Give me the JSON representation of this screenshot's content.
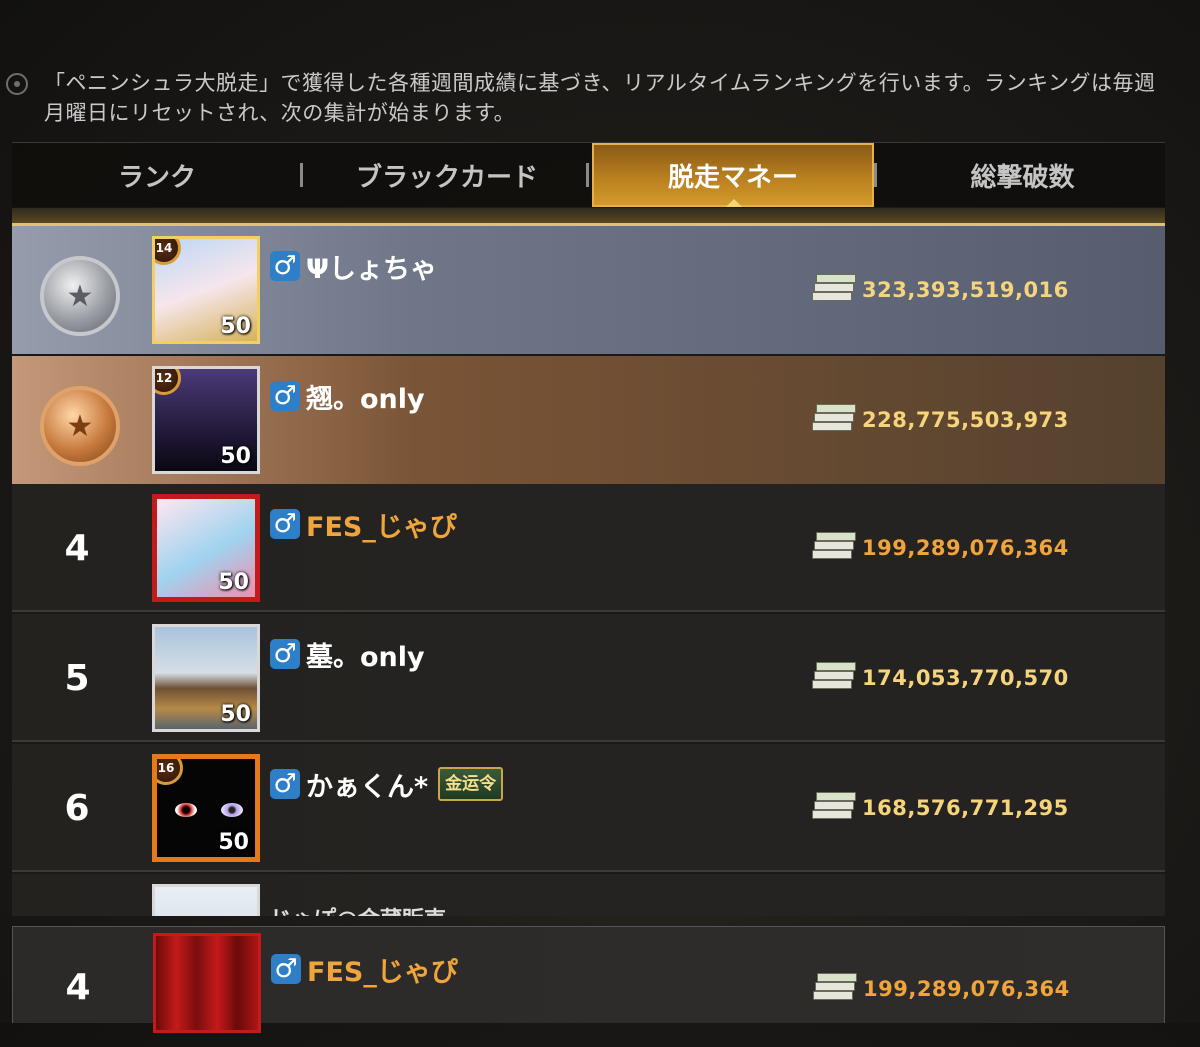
{
  "notice": "「ペニンシュラ大脱走」で獲得した各種週間成績に基づき、リアルタイムランキングを行います。ランキングは毎週月曜日にリセットされ、次の集計が始まります。",
  "tabs": [
    "ランク",
    "ブラックカード",
    "脱走マネー",
    "総撃破数"
  ],
  "active_tab": "脱走マネー",
  "rows": [
    {
      "rank": "",
      "medal": "silver",
      "name": "Ψしょちゃ",
      "level": "50",
      "badge": "14",
      "money": "323,393,519,016",
      "title_badge": ""
    },
    {
      "rank": "",
      "medal": "bronze",
      "name": "翘。only",
      "level": "50",
      "badge": "12",
      "money": "228,775,503,973",
      "title_badge": ""
    },
    {
      "rank": "4",
      "medal": "",
      "name": "FES_じゃぴ",
      "level": "50",
      "badge": "",
      "money": "199,289,076,364",
      "title_badge": ""
    },
    {
      "rank": "5",
      "medal": "",
      "name": "墓。only",
      "level": "50",
      "badge": "",
      "money": "174,053,770,570",
      "title_badge": ""
    },
    {
      "rank": "6",
      "medal": "",
      "name": "かぁくん*",
      "level": "50",
      "badge": "16",
      "money": "168,576,771,295",
      "title_badge": "金运令"
    },
    {
      "rank": "",
      "medal": "",
      "name": "じゃぽ@金蔵販売",
      "level": "",
      "badge": "",
      "money": "",
      "title_badge": ""
    }
  ],
  "self": {
    "rank": "4",
    "name": "FES_じゃぴ",
    "money": "199,289,076,364"
  },
  "colors": {
    "accent": "#d39a2b",
    "money": "#f6d47c",
    "orange_name": "#f0a43c",
    "gender": "#2f7fc8"
  }
}
